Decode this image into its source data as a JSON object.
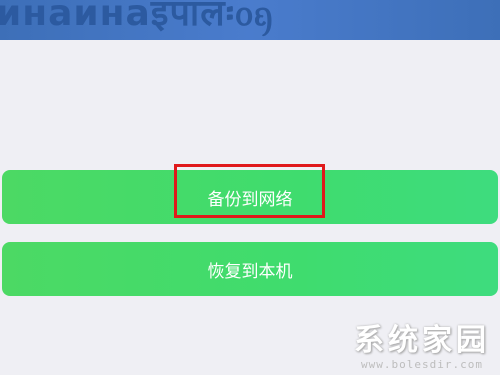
{
  "banner": {
    "text": "инаинаइपाल፡ᦞᦏ"
  },
  "buttons": {
    "backup_label": "备份到网络",
    "restore_label": "恢复到本机"
  },
  "colors": {
    "background": "#efeff4",
    "banner": "#3d6fb8",
    "button_green": "#4cd964",
    "highlight_red": "#e0191b"
  },
  "watermark": {
    "title": "系统家园",
    "url": "www.bolesdir.com"
  }
}
